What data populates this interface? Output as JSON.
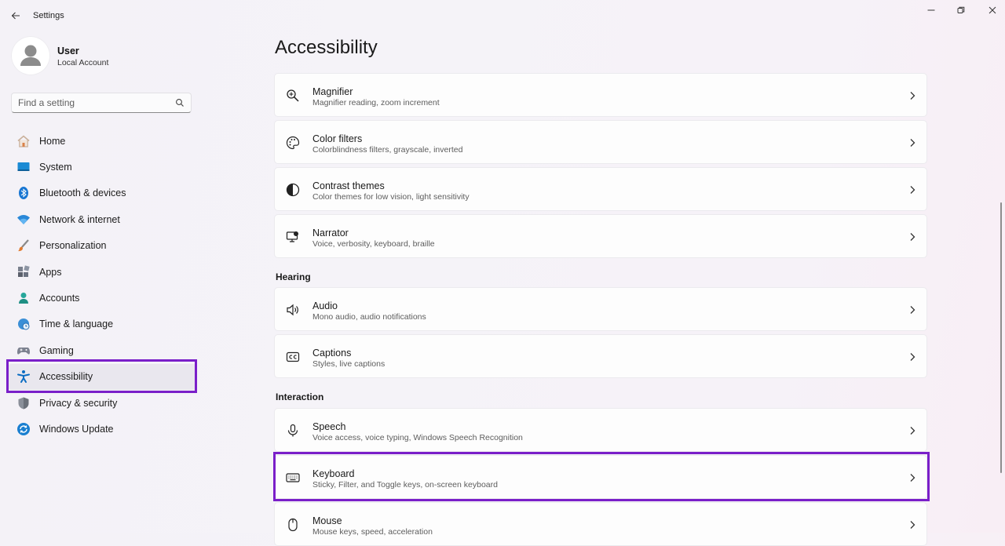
{
  "window": {
    "title": "Settings"
  },
  "user": {
    "name": "User",
    "account_type": "Local Account"
  },
  "search": {
    "placeholder": "Find a setting"
  },
  "sidebar": {
    "items": [
      {
        "label": "Home",
        "icon": "home-icon"
      },
      {
        "label": "System",
        "icon": "system-icon"
      },
      {
        "label": "Bluetooth & devices",
        "icon": "bluetooth-icon"
      },
      {
        "label": "Network & internet",
        "icon": "wifi-icon"
      },
      {
        "label": "Personalization",
        "icon": "brush-icon"
      },
      {
        "label": "Apps",
        "icon": "apps-icon"
      },
      {
        "label": "Accounts",
        "icon": "accounts-icon"
      },
      {
        "label": "Time & language",
        "icon": "globe-clock-icon"
      },
      {
        "label": "Gaming",
        "icon": "gamepad-icon"
      },
      {
        "label": "Accessibility",
        "icon": "accessibility-icon",
        "selected": true
      },
      {
        "label": "Privacy & security",
        "icon": "shield-icon"
      },
      {
        "label": "Windows Update",
        "icon": "update-icon"
      }
    ]
  },
  "main": {
    "title": "Accessibility",
    "vision_items": [
      {
        "title": "Magnifier",
        "subtitle": "Magnifier reading, zoom increment",
        "icon": "magnifier-icon"
      },
      {
        "title": "Color filters",
        "subtitle": "Colorblindness filters, grayscale, inverted",
        "icon": "palette-icon"
      },
      {
        "title": "Contrast themes",
        "subtitle": "Color themes for low vision, light sensitivity",
        "icon": "contrast-icon"
      },
      {
        "title": "Narrator",
        "subtitle": "Voice, verbosity, keyboard, braille",
        "icon": "narrator-icon"
      }
    ],
    "hearing_heading": "Hearing",
    "hearing_items": [
      {
        "title": "Audio",
        "subtitle": "Mono audio, audio notifications",
        "icon": "speaker-icon"
      },
      {
        "title": "Captions",
        "subtitle": "Styles, live captions",
        "icon": "captions-icon"
      }
    ],
    "interaction_heading": "Interaction",
    "interaction_items": [
      {
        "title": "Speech",
        "subtitle": "Voice access, voice typing, Windows Speech Recognition",
        "icon": "microphone-icon"
      },
      {
        "title": "Keyboard",
        "subtitle": "Sticky, Filter, and Toggle keys, on-screen keyboard",
        "icon": "keyboard-icon"
      },
      {
        "title": "Mouse",
        "subtitle": "Mouse keys, speed, acceleration",
        "icon": "mouse-icon"
      }
    ]
  },
  "colors": {
    "highlight": "#7a1fc9",
    "accent": "#0067c0"
  }
}
